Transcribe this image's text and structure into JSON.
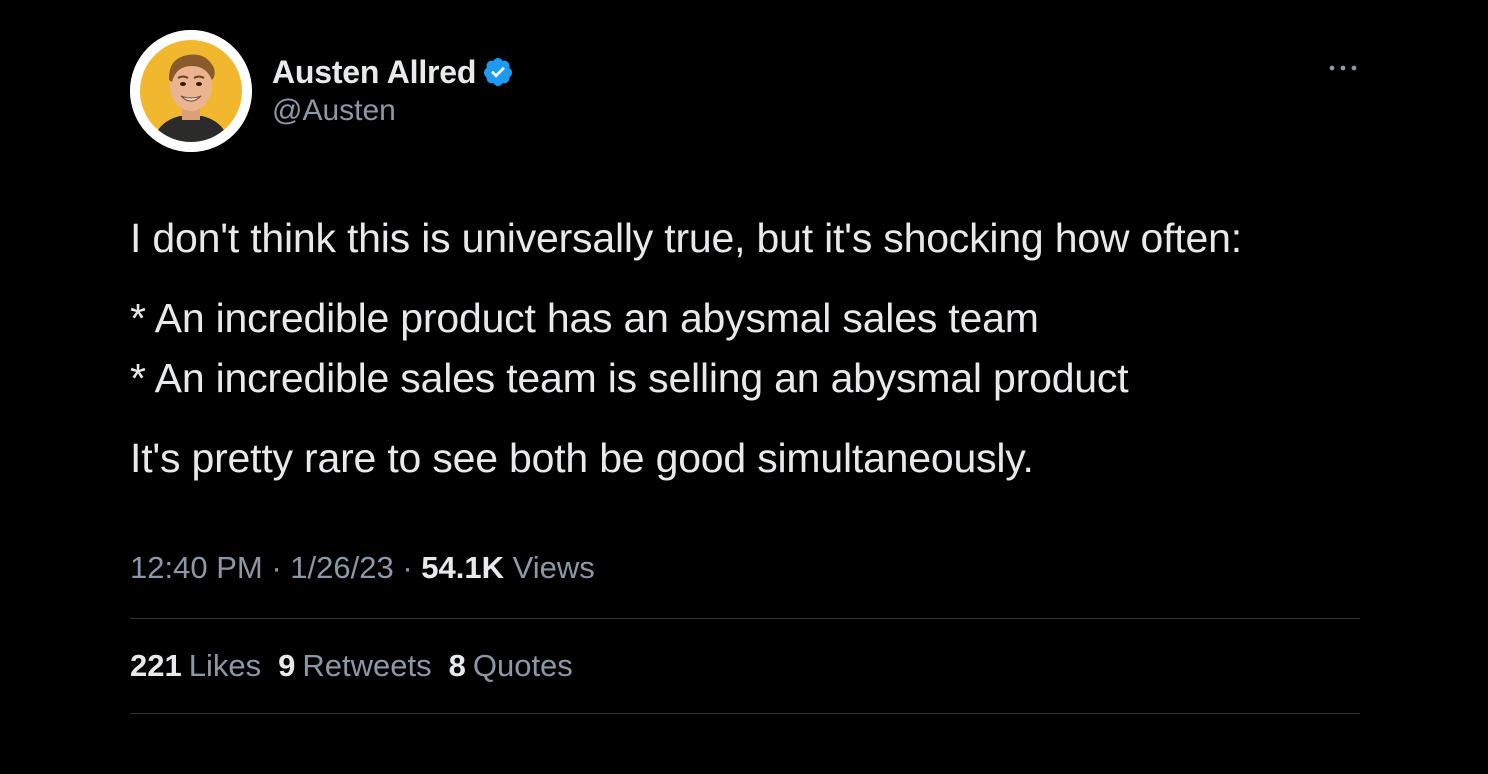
{
  "author": {
    "display_name": "Austen Allred",
    "handle": "@Austen",
    "verified_icon": "verified-badge-icon",
    "avatar_icon": "avatar-cartoon-portrait"
  },
  "tweet": {
    "lines": [
      "I don't think this is universally true, but it's shocking how often:",
      "* An incredible product has an abysmal sales team",
      "* An incredible sales team is selling an abysmal product",
      "It's pretty rare to see both be good simultaneously."
    ]
  },
  "meta": {
    "time": "12:40 PM",
    "separator": "·",
    "date": "1/26/23",
    "views_count": "54.1K",
    "views_label": "Views"
  },
  "stats": {
    "likes_count": "221",
    "likes_label": "Likes",
    "retweets_count": "9",
    "retweets_label": "Retweets",
    "quotes_count": "8",
    "quotes_label": "Quotes"
  },
  "colors": {
    "background": "#000000",
    "primary_text": "#e7e9ea",
    "secondary_text": "#8b98a5",
    "divider": "#2f3336",
    "verified": "#1d9bf0",
    "avatar_bg": "#f0b72f"
  }
}
